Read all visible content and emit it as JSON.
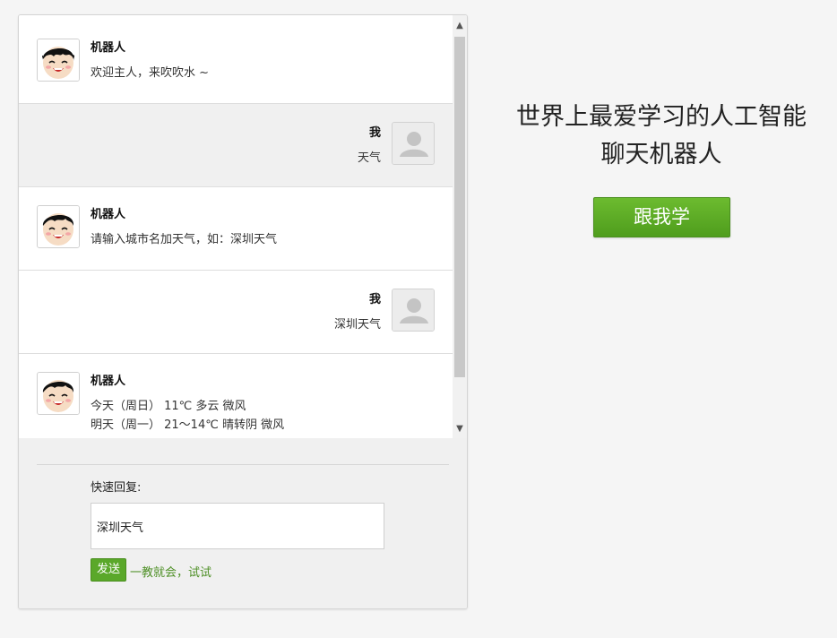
{
  "chat": {
    "messages": [
      {
        "role": "robot",
        "sender": "机器人",
        "lines": [
          "欢迎主人，来吹吹水 ~"
        ]
      },
      {
        "role": "user",
        "sender": "我",
        "lines": [
          "天气"
        ]
      },
      {
        "role": "robot",
        "sender": "机器人",
        "lines": [
          "请输入城市名加天气，如：深圳天气"
        ]
      },
      {
        "role": "user",
        "sender": "我",
        "lines": [
          "深圳天气"
        ]
      },
      {
        "role": "robot",
        "sender": "机器人",
        "lines": [
          "今天（周日） 11℃ 多云 微风",
          "明天（周一） 21～14℃ 晴转阴 微风"
        ]
      }
    ]
  },
  "compose": {
    "quick_reply_label": "快速回复:",
    "input_value": "深圳天气",
    "send_label": "发送",
    "teach_link": "一教就会，试试"
  },
  "side": {
    "title_line1": "世界上最爱学习的人工智能",
    "title_line2": "聊天机器人",
    "learn_button": "跟我学"
  },
  "colors": {
    "accent_green": "#5aa82a",
    "link_green": "#4d8f25"
  },
  "icons": {
    "robot_avatar": "cartoon-face-icon",
    "user_avatar": "person-silhouette-icon",
    "scroll_up": "chevron-up-icon",
    "scroll_down": "chevron-down-icon"
  }
}
